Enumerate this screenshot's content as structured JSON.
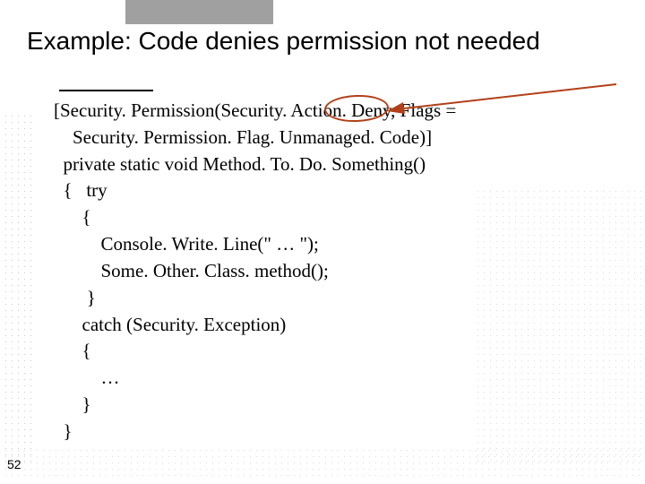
{
  "slide": {
    "title": "Example: Code denies permission not needed",
    "page_number": "52"
  },
  "code": {
    "l1": "[Security. Permission(Security. Action. Deny, Flags =",
    "l2": "    Security. Permission. Flag. Unmanaged. Code)]",
    "l3": "  private static void Method. To. Do. Something()",
    "l4": "  {   try",
    "l5": "      {",
    "l6": "          Console. Write. Line(\" … \");",
    "l7": "          Some. Other. Class. method();",
    "l8": "       }",
    "l9": "      catch (Security. Exception)",
    "l10": "      {",
    "l11": "          …",
    "l12": "      }",
    "l13": "  }"
  },
  "annotation": {
    "ellipse_name": "deny-highlight-ellipse",
    "arrow_name": "arrow-pointer",
    "arrow_color": "#b24019"
  }
}
